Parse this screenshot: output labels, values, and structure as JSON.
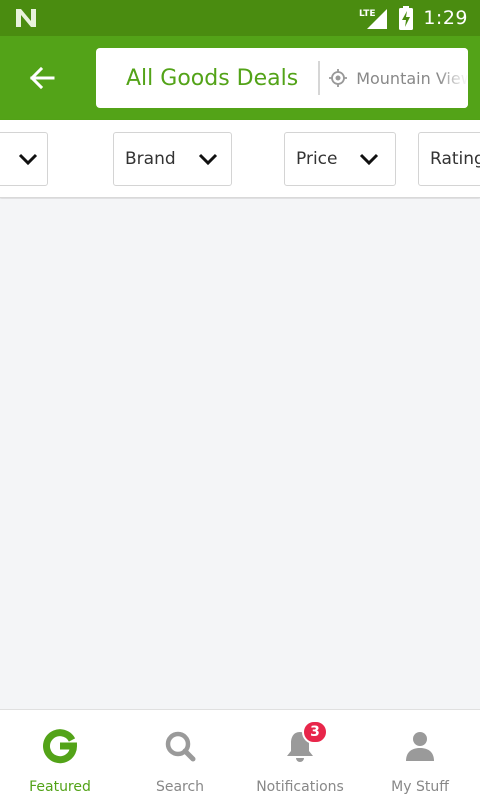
{
  "status_bar": {
    "time": "1:29",
    "network": "LTE"
  },
  "header": {
    "back_icon": "arrow-left-icon",
    "search": {
      "query": "All Goods Deals",
      "location": "Mountain View"
    }
  },
  "filters": [
    {
      "label": ""
    },
    {
      "label": "Brand"
    },
    {
      "label": "Price"
    },
    {
      "label": "Rating"
    }
  ],
  "bottom_nav": {
    "items": [
      {
        "label": "Featured",
        "icon": "groupon-g-icon",
        "active": true
      },
      {
        "label": "Search",
        "icon": "search-icon"
      },
      {
        "label": "Notifications",
        "icon": "bell-icon",
        "badge": "3"
      },
      {
        "label": "My Stuff",
        "icon": "person-icon"
      }
    ]
  },
  "colors": {
    "status_bar": "#4a8c10",
    "brand_green": "#53a318",
    "badge_red": "#e8264a",
    "background": "#f4f5f7"
  }
}
